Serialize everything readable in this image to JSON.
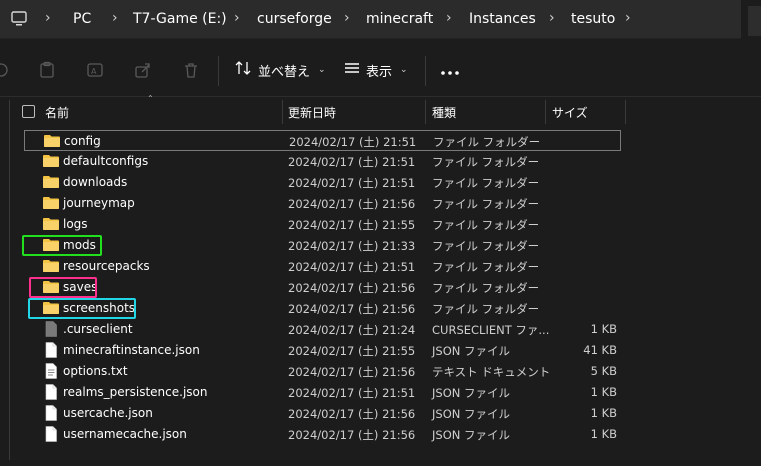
{
  "address_bar": {
    "crumbs": [
      "PC",
      "T7-Game (E:)",
      "curseforge",
      "minecraft",
      "Instances",
      "tesuto"
    ]
  },
  "toolbar": {
    "sort_label": "並べ替え",
    "view_label": "表示",
    "more_label": "..."
  },
  "columns": {
    "name": "名前",
    "date": "更新日時",
    "type": "種類",
    "size": "サイズ"
  },
  "rows": [
    {
      "name": "config",
      "date": "2024/02/17 (土) 21:51",
      "type": "ファイル フォルダー",
      "size": "",
      "icon": "folder-icon"
    },
    {
      "name": "defaultconfigs",
      "date": "2024/02/17 (土) 21:51",
      "type": "ファイル フォルダー",
      "size": "",
      "icon": "folder-icon"
    },
    {
      "name": "downloads",
      "date": "2024/02/17 (土) 21:51",
      "type": "ファイル フォルダー",
      "size": "",
      "icon": "folder-icon"
    },
    {
      "name": "journeymap",
      "date": "2024/02/17 (土) 21:56",
      "type": "ファイル フォルダー",
      "size": "",
      "icon": "folder-icon"
    },
    {
      "name": "logs",
      "date": "2024/02/17 (土) 21:55",
      "type": "ファイル フォルダー",
      "size": "",
      "icon": "folder-icon"
    },
    {
      "name": "mods",
      "date": "2024/02/17 (土) 21:33",
      "type": "ファイル フォルダー",
      "size": "",
      "icon": "folder-icon"
    },
    {
      "name": "resourcepacks",
      "date": "2024/02/17 (土) 21:51",
      "type": "ファイル フォルダー",
      "size": "",
      "icon": "folder-icon"
    },
    {
      "name": "saves",
      "date": "2024/02/17 (土) 21:56",
      "type": "ファイル フォルダー",
      "size": "",
      "icon": "folder-icon"
    },
    {
      "name": "screenshots",
      "date": "2024/02/17 (土) 21:56",
      "type": "ファイル フォルダー",
      "size": "",
      "icon": "folder-icon"
    },
    {
      "name": ".curseclient",
      "date": "2024/02/17 (土) 21:24",
      "type": "CURSECLIENT ファ...",
      "size": "1 KB",
      "icon": "generic-file-icon"
    },
    {
      "name": "minecraftinstance.json",
      "date": "2024/02/17 (土) 21:55",
      "type": "JSON ファイル",
      "size": "41 KB",
      "icon": "file-icon"
    },
    {
      "name": "options.txt",
      "date": "2024/02/17 (土) 21:56",
      "type": "テキスト ドキュメント",
      "size": "5 KB",
      "icon": "text-file-icon"
    },
    {
      "name": "realms_persistence.json",
      "date": "2024/02/17 (土) 21:51",
      "type": "JSON ファイル",
      "size": "1 KB",
      "icon": "file-icon"
    },
    {
      "name": "usercache.json",
      "date": "2024/02/17 (土) 21:56",
      "type": "JSON ファイル",
      "size": "1 KB",
      "icon": "file-icon"
    },
    {
      "name": "usernamecache.json",
      "date": "2024/02/17 (土) 21:56",
      "type": "JSON ファイル",
      "size": "1 KB",
      "icon": "file-icon"
    }
  ],
  "highlights": [
    {
      "row": "mods",
      "color": "#22e01e"
    },
    {
      "row": "saves",
      "color": "#ff2f8e"
    },
    {
      "row": "screenshots",
      "color": "#22d6e6"
    }
  ],
  "colors": {
    "background": "#1c1c1c",
    "folder": "#f3c343",
    "selected_border": "#7a7a7a"
  }
}
